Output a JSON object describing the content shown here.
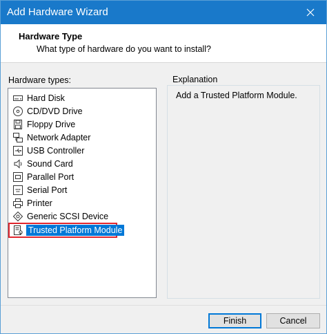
{
  "window": {
    "title": "Add Hardware Wizard"
  },
  "header": {
    "title": "Hardware Type",
    "subtitle": "What type of hardware do you want to install?"
  },
  "hardware_types": {
    "label": "Hardware types:",
    "items": [
      {
        "label": "Hard Disk",
        "icon": "hard-disk-icon"
      },
      {
        "label": "CD/DVD Drive",
        "icon": "cd-dvd-drive-icon"
      },
      {
        "label": "Floppy Drive",
        "icon": "floppy-drive-icon"
      },
      {
        "label": "Network Adapter",
        "icon": "network-adapter-icon"
      },
      {
        "label": "USB Controller",
        "icon": "usb-controller-icon"
      },
      {
        "label": "Sound Card",
        "icon": "sound-card-icon"
      },
      {
        "label": "Parallel Port",
        "icon": "parallel-port-icon"
      },
      {
        "label": "Serial Port",
        "icon": "serial-port-icon"
      },
      {
        "label": "Printer",
        "icon": "printer-icon"
      },
      {
        "label": "Generic SCSI Device",
        "icon": "scsi-device-icon"
      },
      {
        "label": "Trusted Platform Module",
        "icon": "tpm-icon",
        "selected": true
      }
    ]
  },
  "explanation": {
    "label": "Explanation",
    "text": "Add a Trusted Platform Module."
  },
  "buttons": {
    "finish": "Finish",
    "cancel": "Cancel"
  },
  "colors": {
    "titlebar": "#1979ca",
    "selection": "#0078d7",
    "highlight_border": "#e0262e"
  }
}
